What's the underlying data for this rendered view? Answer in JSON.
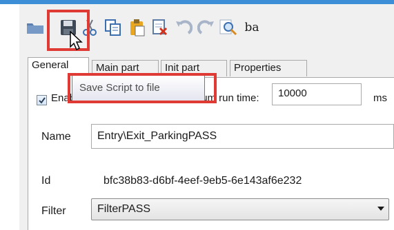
{
  "colors": {
    "highlight": "#e03a35",
    "title_bar": "#3c8fd6"
  },
  "toolbar": {
    "buttons": [
      {
        "icon": "open-folder-icon"
      },
      {
        "icon": "save-icon"
      },
      {
        "icon": "cut-icon"
      },
      {
        "icon": "copy-icon"
      },
      {
        "icon": "paste-icon"
      },
      {
        "icon": "delete-icon"
      },
      {
        "icon": "undo-icon"
      },
      {
        "icon": "redo-icon"
      },
      {
        "icon": "find-icon"
      },
      {
        "icon": "replace-icon",
        "text": "ba"
      }
    ]
  },
  "tabs": [
    {
      "label": "General",
      "active": true
    },
    {
      "label": "Main part",
      "active": false
    },
    {
      "label": "Init part",
      "active": false
    },
    {
      "label": "Properties",
      "active": false
    }
  ],
  "tooltip": {
    "text": "Save Script to file"
  },
  "general": {
    "enabled_label": "Enabled",
    "enabled_checked": true,
    "max_runtime_label": "Maximum run time:",
    "max_runtime_value": "10000",
    "max_runtime_unit": "ms",
    "name_label": "Name",
    "name_value": "Entry\\Exit_ParkingPASS",
    "id_label": "Id",
    "id_value": "bfc38b83-d6bf-4eef-9eb5-6e143af6e232",
    "filter_label": "Filter",
    "filter_value": "FilterPASS"
  }
}
